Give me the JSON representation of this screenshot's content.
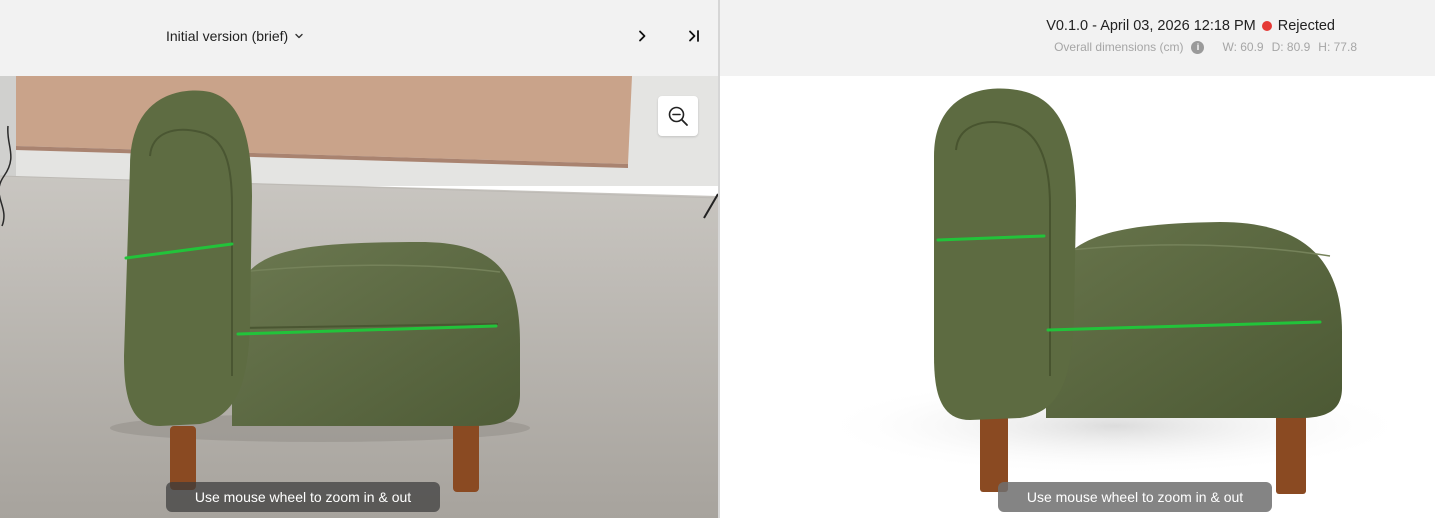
{
  "left_pane": {
    "version_label": "Initial version (brief)",
    "next_icon": "chevron-right-icon",
    "last_icon": "skip-to-end-icon",
    "zoom_icon": "zoom-out-icon",
    "zoom_hint": "Use mouse wheel to zoom in & out"
  },
  "right_pane": {
    "version_info": "V0.1.0 - April 03, 2026 12:18 PM",
    "status": {
      "label": "Rejected",
      "color": "#e53935"
    },
    "dimensions": {
      "label": "Overall dimensions (cm)",
      "info_icon": "info-icon",
      "width": "W: 60.9",
      "depth": "D: 80.9",
      "height": "H: 77.8"
    },
    "zoom_hint": "Use mouse wheel to zoom in & out"
  },
  "colors": {
    "header_bg": "#f2f2f2",
    "measure_line": "#22c33a",
    "fabric": "#5b6a3e",
    "leg": "#8a4a22"
  }
}
